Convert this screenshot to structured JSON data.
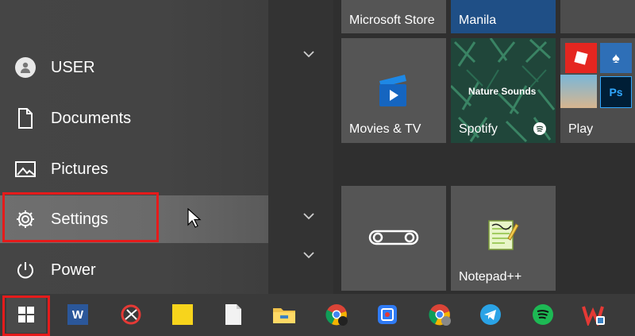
{
  "start_menu": {
    "items": [
      {
        "label": "USER",
        "icon": "user-avatar-icon"
      },
      {
        "label": "Documents",
        "icon": "document-icon"
      },
      {
        "label": "Pictures",
        "icon": "pictures-icon"
      },
      {
        "label": "Settings",
        "icon": "gear-icon"
      },
      {
        "label": "Power",
        "icon": "power-icon"
      }
    ]
  },
  "tiles": {
    "microsoft_store": "Microsoft Store",
    "weather_city": "Manila",
    "movies_tv": "Movies & TV",
    "spotify": "Spotify",
    "spotify_overlay": "Nature Sounds",
    "play": "Play",
    "notepadpp": "Notepad++",
    "photoshop_badge": "Ps"
  },
  "taskbar": {
    "items": [
      "windows-start-icon",
      "word-icon",
      "snipping-tool-icon",
      "sticky-notes-icon",
      "blank-document-icon",
      "file-explorer-icon",
      "chrome-icon",
      "screen-recorder-icon",
      "chrome-profile-icon",
      "telegram-icon",
      "spotify-icon",
      "wps-icon"
    ],
    "word_letter": "W"
  },
  "colors": {
    "accent_red": "#e51b1b",
    "weather_tile": "#1f4f86",
    "spotify_green": "#1db954"
  }
}
